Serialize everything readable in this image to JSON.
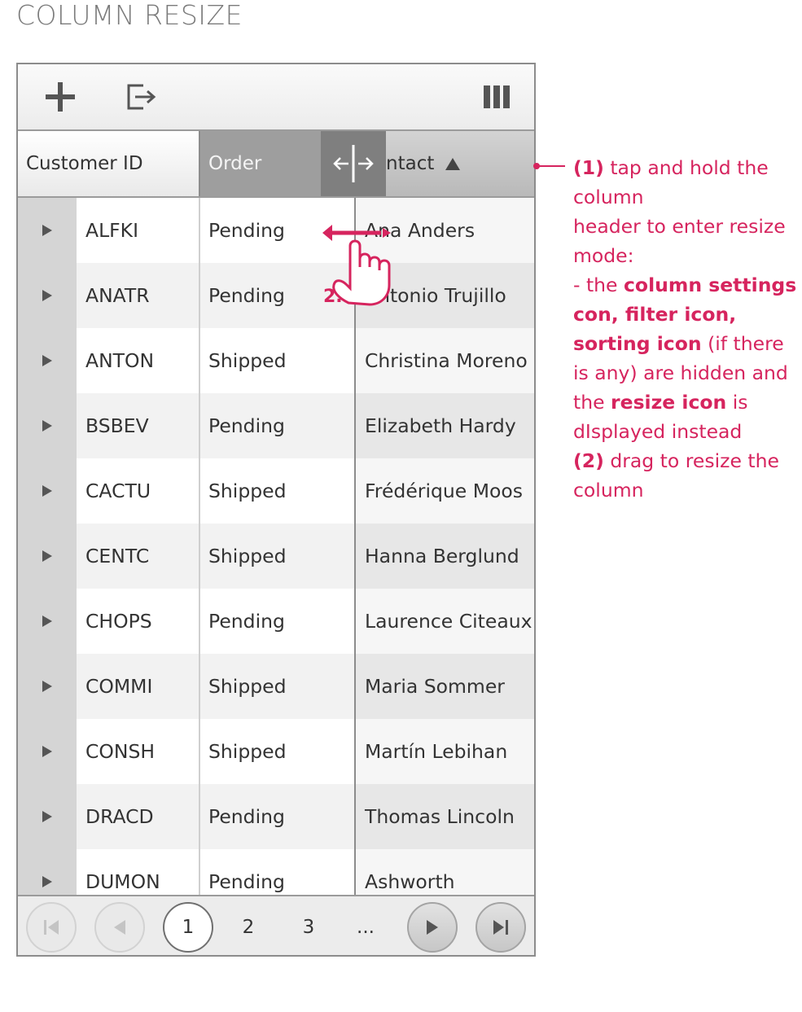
{
  "page": {
    "title": "COLUMN RESIZE"
  },
  "toolbar": {
    "add_icon": "plus-icon",
    "export_icon": "export-icon",
    "columns_icon": "columns-icon"
  },
  "header": {
    "customer_id": "Customer ID",
    "order": "Order",
    "contact": "ntact",
    "sort_icon": "sort-ascending-icon",
    "resize_icon": "resize-icon"
  },
  "rows": [
    {
      "id": "ALFKI",
      "status": "Pending",
      "contact": "Ana Anders"
    },
    {
      "id": "ANATR",
      "status": "Pending",
      "contact": "Antonio Trujillo"
    },
    {
      "id": "ANTON",
      "status": "Shipped",
      "contact": "Christina Moreno"
    },
    {
      "id": "BSBEV",
      "status": "Pending",
      "contact": "Elizabeth Hardy"
    },
    {
      "id": "CACTU",
      "status": "Shipped",
      "contact": "Frédérique Moos"
    },
    {
      "id": "CENTC",
      "status": "Shipped",
      "contact": "Hanna Berglund"
    },
    {
      "id": "CHOPS",
      "status": "Pending",
      "contact": "Laurence Citeaux"
    },
    {
      "id": "COMMI",
      "status": "Shipped",
      "contact": "Maria Sommer"
    },
    {
      "id": "CONSH",
      "status": "Shipped",
      "contact": "Martín Lebihan"
    },
    {
      "id": "DRACD",
      "status": "Pending",
      "contact": "Thomas Lincoln"
    },
    {
      "id": "DUMON",
      "status": "Pending",
      "contact": "Ashworth"
    }
  ],
  "pager": {
    "pages": [
      "1",
      "2",
      "3"
    ],
    "ellipsis": "...",
    "current": "1"
  },
  "annotation": {
    "step1_num": "(1)",
    "step1_a": " tap and hold the column",
    "step1_b": "header to enter resize mode:",
    "dash": "- the ",
    "bold1": "column settings con, filter icon, sorting icon",
    "mid": " (if there is any) are hidden and the ",
    "bold2": "resize icon",
    "tail": " is dIsplayed instead",
    "step2_num": "(2)",
    "step2_text": " drag to resize the column",
    "marker": "2."
  },
  "colors": {
    "accent": "#d6245e",
    "header_active": "#9e9e9e",
    "resize_header": "#7f7f7f"
  }
}
